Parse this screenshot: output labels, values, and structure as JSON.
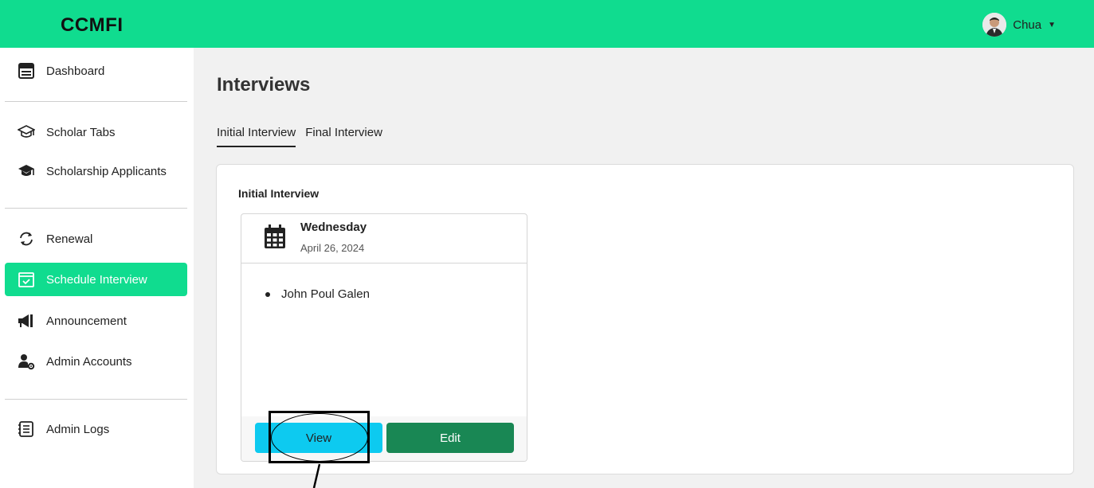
{
  "header": {
    "brand": "CCMFI",
    "user_name": "Chua"
  },
  "sidebar": {
    "items": [
      {
        "label": "Dashboard",
        "icon": "dashboard-icon"
      },
      {
        "label": "Scholar Tabs",
        "icon": "graduation-cap-outline-icon"
      },
      {
        "label": "Scholarship Applicants",
        "icon": "graduation-cap-icon"
      },
      {
        "label": "Renewal",
        "icon": "refresh-icon"
      },
      {
        "label": "Schedule Interview",
        "icon": "calendar-check-icon",
        "active": true
      },
      {
        "label": "Announcement",
        "icon": "megaphone-icon"
      },
      {
        "label": "Admin Accounts",
        "icon": "user-gear-icon"
      },
      {
        "label": "Admin Logs",
        "icon": "log-list-icon"
      }
    ]
  },
  "main": {
    "title": "Interviews",
    "tabs": [
      {
        "label": "Initial Interview",
        "active": true
      },
      {
        "label": "Final Interview",
        "active": false
      }
    ],
    "section_title": "Initial Interview",
    "interview": {
      "day": "Wednesday",
      "date": "April 26, 2024",
      "names": [
        "John Poul Galen"
      ],
      "view_label": "View",
      "edit_label": "Edit"
    }
  },
  "colors": {
    "accent": "#10dc8f",
    "view_button": "#0dcaf0",
    "edit_button": "#198754"
  }
}
